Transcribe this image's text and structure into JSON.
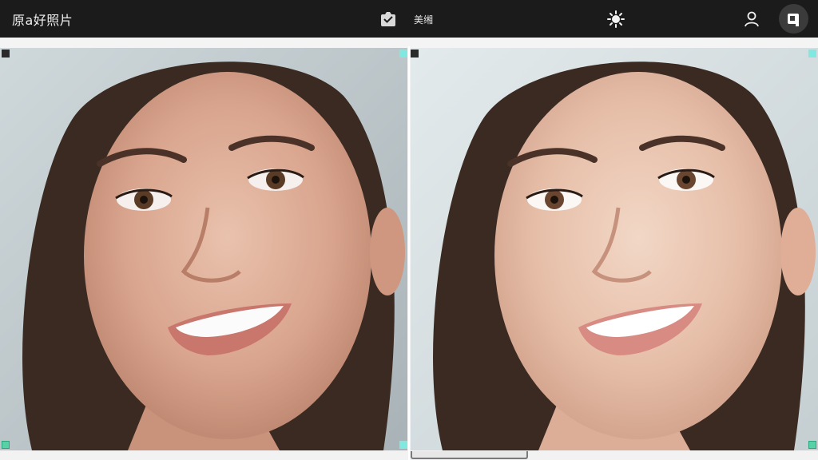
{
  "header": {
    "left_title": "原a好照片",
    "right_title": "美缃"
  },
  "icons": {
    "save": "save-check-icon",
    "enhance": "sparkle-enhance-icon",
    "user": "user-icon",
    "avatar": "app-avatar-icon"
  },
  "panes": {
    "before": "original-photo",
    "after": "retouched-photo"
  },
  "colors": {
    "topbar": "#1b1b1b",
    "accent": "#7fe8e0"
  }
}
